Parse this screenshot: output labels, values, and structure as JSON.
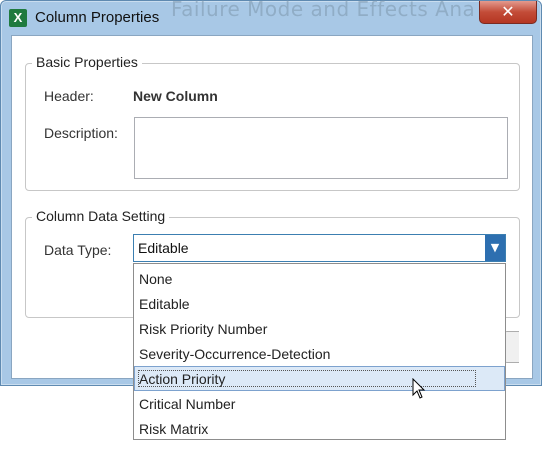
{
  "window": {
    "title": "Column Properties",
    "background_title": "Failure Mode and Effects Ana",
    "app_icon": "excel-icon",
    "app_icon_letter": "X",
    "close_label": "✕"
  },
  "basic": {
    "legend": "Basic Properties",
    "header_label": "Header:",
    "header_value": "New Column",
    "description_label": "Description:",
    "description_value": ""
  },
  "column_data": {
    "legend": "Column Data Setting",
    "data_type_label": "Data Type:",
    "data_type_value": "Editable"
  },
  "dropdown": {
    "options": [
      "None",
      "Editable",
      "Risk Priority Number",
      "Severity-Occurrence-Detection",
      "Action Priority",
      "Critical Number",
      "Risk Matrix"
    ],
    "hovered_index": 4
  },
  "colors": {
    "accent": "#2d6fb0",
    "hover": "#dce9f7",
    "close": "#c34c38"
  }
}
